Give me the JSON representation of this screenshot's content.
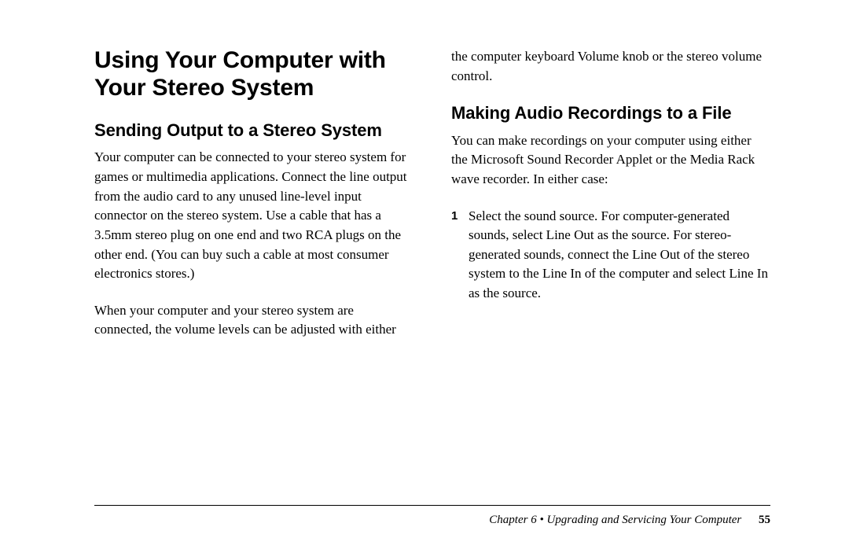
{
  "main_heading": "Using Your Computer with Your Stereo System",
  "section1": {
    "heading": "Sending Output to a Stereo System",
    "para1": "Your computer can be connected to your stereo system for games or multimedia applications. Connect the line output from the audio card to any unused line-level input connector on the stereo system. Use a cable that has a 3.5mm stereo plug on one end and two RCA plugs on the other end. (You can buy such a cable at most consumer electronics stores.)",
    "para2": "When your computer and your stereo system are connected, the volume levels can be adjusted with either the computer keyboard Volume knob or the stereo volume control."
  },
  "section2": {
    "heading": "Making Audio Recordings to a File",
    "intro": "You can make recordings on your computer using either the Microsoft Sound Recorder Applet or the Media Rack wave recorder. In either case:",
    "step1_num": "1",
    "step1_text": "Select the sound source. For computer-generated sounds, select Line Out as the source. For stereo-generated sounds, connect the Line Out of the stereo system to the Line In of the computer and select Line In as the source."
  },
  "footer": {
    "chapter": "Chapter 6  •  Upgrading and Servicing Your Computer",
    "page": "55"
  }
}
